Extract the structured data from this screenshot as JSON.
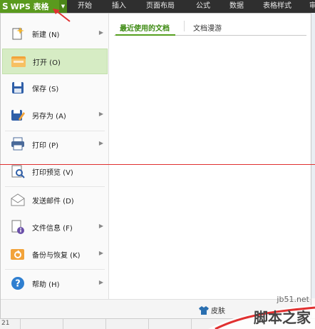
{
  "app": {
    "logo_glyph": "S",
    "title": "WPS 表格",
    "dropdown_glyph": "▼"
  },
  "ribbon_tabs": [
    {
      "label": "开始"
    },
    {
      "label": "插入"
    },
    {
      "label": "页面布局"
    },
    {
      "label": "公式"
    },
    {
      "label": "数据"
    },
    {
      "label": "表格样式"
    },
    {
      "label": "审"
    }
  ],
  "menu": {
    "items": [
      {
        "label": "新建 (N)",
        "icon": "new-icon",
        "has_submenu": true
      },
      {
        "label": "打开 (O)",
        "icon": "folder-open-icon",
        "has_submenu": false,
        "selected": true
      },
      {
        "label": "保存 (S)",
        "icon": "save-icon",
        "has_submenu": false
      },
      {
        "label": "另存为 (A)",
        "icon": "save-as-icon",
        "has_submenu": true
      },
      {
        "label": "打印 (P)",
        "icon": "print-icon",
        "has_submenu": true
      },
      {
        "label": "打印预览 (V)",
        "icon": "print-preview-icon",
        "has_submenu": false
      },
      {
        "label": "发送邮件 (D)",
        "icon": "mail-icon",
        "has_submenu": false
      },
      {
        "label": "文件信息 (F)",
        "icon": "file-info-icon",
        "has_submenu": true
      },
      {
        "label": "备份与恢复 (K)",
        "icon": "backup-icon",
        "has_submenu": true
      },
      {
        "label": "帮助 (H)",
        "icon": "help-icon",
        "has_submenu": true
      }
    ],
    "right_tabs": [
      {
        "label": "最近使用的文档",
        "active": true
      },
      {
        "label": "文档漫游",
        "active": false
      }
    ],
    "skin_label": "皮肤"
  },
  "sheet": {
    "row_label": "21"
  },
  "watermark": {
    "url": "jb51.net",
    "name": "脚本之家"
  },
  "colors": {
    "accent": "#5a9a1e",
    "selected_bg": "#d6ecc4",
    "tab_active": "#3d8a12",
    "annotation_red": "#e03030"
  }
}
